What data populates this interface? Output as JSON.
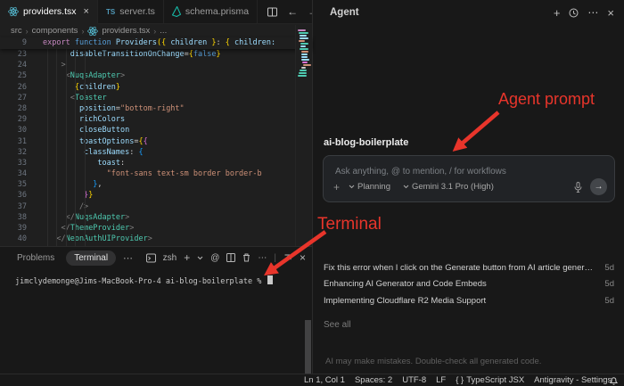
{
  "tabbar": {
    "tabs": [
      {
        "label": "providers.tsx",
        "icon": "react",
        "active": true,
        "closable": true
      },
      {
        "label": "server.ts",
        "icon": "ts",
        "active": false,
        "closable": false
      },
      {
        "label": "schema.prisma",
        "icon": "prisma",
        "active": false,
        "closable": false
      }
    ]
  },
  "breadcrumb": {
    "items": [
      "src",
      "components",
      "providers.tsx",
      "..."
    ]
  },
  "editor": {
    "sticky": {
      "no": "9",
      "tokens": [
        {
          "c": "kw",
          "t": "export "
        },
        {
          "c": "kwb",
          "t": "function "
        },
        {
          "c": "fn",
          "t": "Providers"
        },
        {
          "c": "b1",
          "t": "({"
        },
        {
          "c": "attr",
          "t": " children "
        },
        {
          "c": "b1",
          "t": "}"
        },
        {
          "c": "fg",
          "t": ": "
        },
        {
          "c": "b1",
          "t": "{"
        },
        {
          "c": "attr",
          "t": " children:"
        }
      ]
    },
    "lines": [
      {
        "no": "23",
        "tokens": [
          {
            "c": "attr",
            "t": "      disableTransitionOnChange"
          },
          {
            "c": "fg",
            "t": "="
          },
          {
            "c": "b1",
            "t": "{"
          },
          {
            "c": "kwb",
            "t": "false"
          },
          {
            "c": "b1",
            "t": "}"
          }
        ]
      },
      {
        "no": "24",
        "tokens": [
          {
            "c": "punc",
            "t": "    >"
          }
        ]
      },
      {
        "no": "25",
        "tokens": [
          {
            "c": "punc",
            "t": "     <"
          },
          {
            "c": "tag",
            "t": "NuqsAdapter"
          },
          {
            "c": "punc",
            "t": ">"
          }
        ]
      },
      {
        "no": "26",
        "tokens": [
          {
            "c": "b1",
            "t": "       {"
          },
          {
            "c": "attr",
            "t": "children"
          },
          {
            "c": "b1",
            "t": "}"
          }
        ]
      },
      {
        "no": "27",
        "tokens": [
          {
            "c": "punc",
            "t": "      <"
          },
          {
            "c": "tag",
            "t": "Toaster"
          }
        ]
      },
      {
        "no": "28",
        "tokens": [
          {
            "c": "attr",
            "t": "        position"
          },
          {
            "c": "fg",
            "t": "="
          },
          {
            "c": "str",
            "t": "\"bottom-right\""
          }
        ]
      },
      {
        "no": "29",
        "tokens": [
          {
            "c": "attr",
            "t": "        richColors"
          }
        ]
      },
      {
        "no": "30",
        "tokens": [
          {
            "c": "attr",
            "t": "        closeButton"
          }
        ]
      },
      {
        "no": "31",
        "tokens": [
          {
            "c": "attr",
            "t": "        toastOptions"
          },
          {
            "c": "fg",
            "t": "="
          },
          {
            "c": "b1",
            "t": "{"
          },
          {
            "c": "b2",
            "t": "{"
          }
        ]
      },
      {
        "no": "32",
        "tokens": [
          {
            "c": "attr",
            "t": "         classNames"
          },
          {
            "c": "fg",
            "t": ": "
          },
          {
            "c": "b3",
            "t": "{"
          }
        ]
      },
      {
        "no": "33",
        "tokens": [
          {
            "c": "attr",
            "t": "            toast"
          },
          {
            "c": "fg",
            "t": ":"
          }
        ]
      },
      {
        "no": "34",
        "tokens": [
          {
            "c": "str",
            "t": "              \"font-sans text-sm border border-b"
          }
        ]
      },
      {
        "no": "35",
        "tokens": [
          {
            "c": "b3",
            "t": "           }"
          },
          {
            "c": "fg",
            "t": ","
          }
        ]
      },
      {
        "no": "36",
        "tokens": [
          {
            "c": "b2",
            "t": "         }"
          },
          {
            "c": "b1",
            "t": "}"
          }
        ]
      },
      {
        "no": "37",
        "tokens": [
          {
            "c": "punc",
            "t": "        />"
          }
        ]
      },
      {
        "no": "38",
        "tokens": [
          {
            "c": "punc",
            "t": "     </"
          },
          {
            "c": "tag",
            "t": "NuqsAdapter"
          },
          {
            "c": "punc",
            "t": ">"
          }
        ]
      },
      {
        "no": "39",
        "tokens": [
          {
            "c": "punc",
            "t": "    </"
          },
          {
            "c": "tag",
            "t": "ThemeProvider"
          },
          {
            "c": "punc",
            "t": ">"
          }
        ]
      },
      {
        "no": "40",
        "tokens": [
          {
            "c": "punc",
            "t": "   </"
          },
          {
            "c": "tag",
            "t": "NeonAuthUIProvider"
          },
          {
            "c": "punc",
            "t": ">"
          }
        ]
      }
    ]
  },
  "terminal": {
    "tabs": [
      {
        "label": "Problems",
        "active": false
      },
      {
        "label": "Terminal",
        "active": true
      }
    ],
    "shell_label": "zsh",
    "prompt": "jimclydemonge@Jims-MacBook-Pro-4 ai-blog-boilerplate % "
  },
  "agent": {
    "title": "Agent",
    "session_title": "ai-blog-boilerplate",
    "input_placeholder": "Ask anything, @ to mention, / for workflows",
    "mode": "Planning",
    "model": "Gemini 3.1 Pro (High)",
    "history": [
      {
        "label": "Fix this error when I click on the Generate button from AI article generator",
        "time": "5d"
      },
      {
        "label": "Enhancing AI Generator and Code Embeds",
        "time": "5d"
      },
      {
        "label": "Implementing Cloudflare R2 Media Support",
        "time": "5d"
      }
    ],
    "see_all": "See all",
    "disclaimer": "AI may make mistakes. Double-check all generated code."
  },
  "statusbar": {
    "items": [
      "Ln 1, Col 1",
      "Spaces: 2",
      "UTF-8",
      "LF"
    ],
    "language": {
      "icon": "{ }",
      "label": "TypeScript JSX"
    },
    "product": "Antigravity - Settings"
  },
  "annotations": {
    "prompt_label": "Agent prompt",
    "terminal_label": "Terminal",
    "arrow_color": "#e8352b"
  },
  "icons": {
    "back": "←",
    "forward": "→",
    "more": "⋯",
    "close": "×",
    "plus": "+",
    "at": "@",
    "send": "→",
    "sep": "|",
    "crumb": "›",
    "ts": "TS"
  }
}
